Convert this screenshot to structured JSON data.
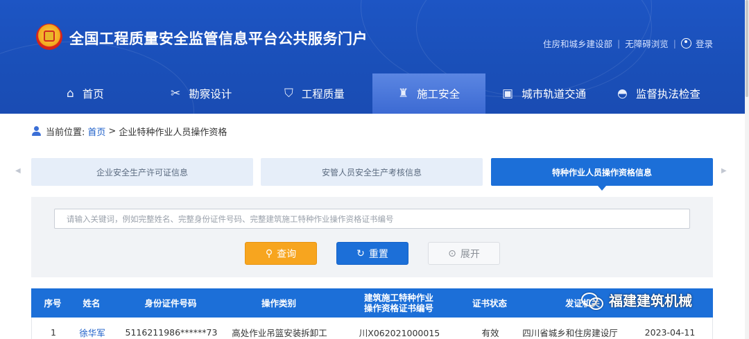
{
  "header": {
    "site_title": "全国工程质量安全监管信息平台公共服务门户",
    "links": {
      "ministry": "住房和城乡建设部",
      "accessibility": "无障碍浏览",
      "login": "登录"
    }
  },
  "nav": {
    "items": [
      {
        "label": "首页",
        "icon": "home-icon"
      },
      {
        "label": "勘察设计",
        "icon": "tools-icon"
      },
      {
        "label": "工程质量",
        "icon": "shield-icon"
      },
      {
        "label": "施工安全",
        "icon": "worker-icon",
        "active": true
      },
      {
        "label": "城市轨道交通",
        "icon": "train-icon"
      },
      {
        "label": "监督执法检查",
        "icon": "police-cap-icon"
      }
    ]
  },
  "breadcrumb": {
    "prefix": "当前位置:",
    "home": "首页",
    "separator": ">",
    "current": "企业特种作业人员操作资格"
  },
  "tabs": [
    {
      "label": "企业安全生产许可证信息"
    },
    {
      "label": "安管人员安全生产考核信息"
    },
    {
      "label": "特种作业人员操作资格信息",
      "active": true
    }
  ],
  "search": {
    "placeholder": "请输入关键词，例如完整姓名、完整身份证件号码、完整建筑施工特种作业操作资格证书编号",
    "query_label": "查询",
    "reset_label": "重置",
    "expand_label": "展开"
  },
  "table": {
    "headers": {
      "index": "序号",
      "name": "姓名",
      "id_no": "身份证件号码",
      "category": "操作类别",
      "cert_line1": "建筑施工特种作业",
      "cert_line2": "操作资格证书编号",
      "status": "证书状态",
      "issuer": "发证机关"
    },
    "rows": [
      {
        "index": "1",
        "name": "徐华军",
        "id_no": "5116211986******73",
        "category": "高处作业吊篮安装拆卸工",
        "cert_no": "川X062021000015",
        "status": "有效",
        "issuer": "四川省城乡和住房建设厅",
        "date": "2023-04-11"
      }
    ]
  },
  "watermark": {
    "text": "福建建筑机械"
  },
  "colors": {
    "header_blue": "#1a4fb8",
    "primary_blue": "#1c6fd8",
    "query_orange": "#f7a51f",
    "link_blue": "#1a5dc8"
  }
}
